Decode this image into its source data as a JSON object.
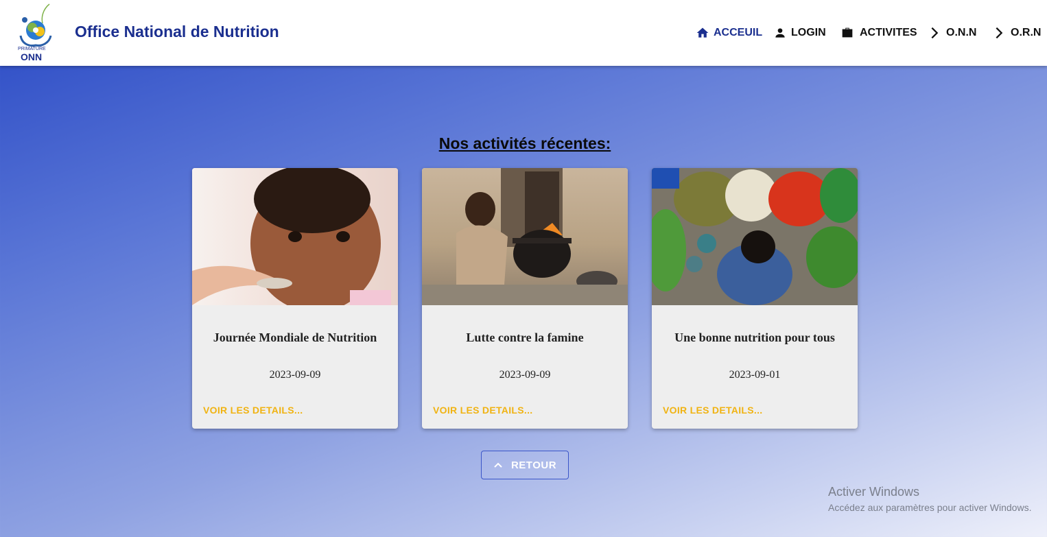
{
  "header": {
    "brand": "Office National de Nutrition",
    "logo_text": "PRIMATURE",
    "logo_acronym": "ONN",
    "nav": [
      {
        "label": "ACCEUIL",
        "icon": "home-icon",
        "active": true
      },
      {
        "label": "LOGIN",
        "icon": "person-icon",
        "active": false
      },
      {
        "label": "ACTIVITES",
        "icon": "briefcase-icon",
        "active": false
      },
      {
        "label": "O.N.N",
        "icon": "chevron-right-icon",
        "active": false
      },
      {
        "label": "O.R.N",
        "icon": "chevron-right-icon",
        "active": false
      }
    ]
  },
  "main": {
    "section_title": "Nos activités récentes:",
    "cards": [
      {
        "title": "Journée Mondiale de Nutrition",
        "date": "2023-09-09",
        "link": "VOIR LES DETAILS...",
        "image": "baby-feeding-photo"
      },
      {
        "title": "Lutte contre la famine",
        "date": "2023-09-09",
        "link": "VOIR LES DETAILS...",
        "image": "child-cooking-pot-photo"
      },
      {
        "title": "Une bonne nutrition pour tous",
        "date": "2023-09-01",
        "link": "VOIR LES DETAILS...",
        "image": "market-vegetables-photo"
      }
    ],
    "back_button": "RETOUR"
  },
  "watermark": {
    "title": "Activer Windows",
    "subtitle": "Accédez aux paramètres pour activer Windows."
  },
  "colors": {
    "brand": "#1b2f8f",
    "link": "#f0b312",
    "card_bg": "#eeeeee"
  }
}
